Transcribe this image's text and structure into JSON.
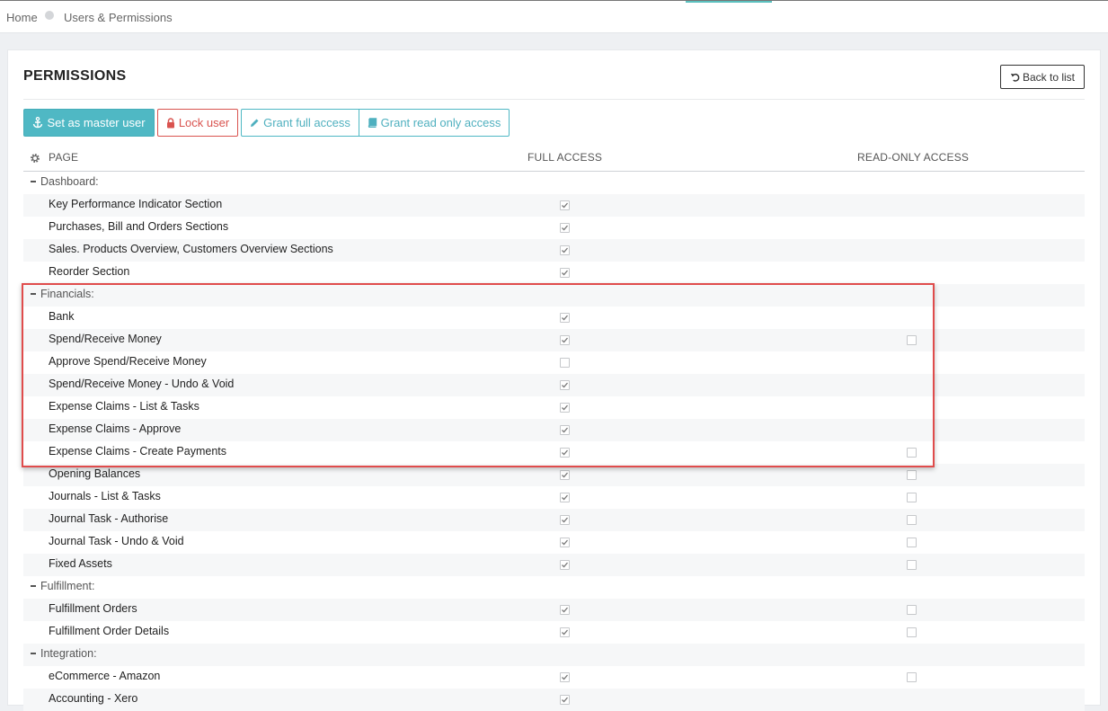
{
  "breadcrumb": {
    "home": "Home",
    "current": "Users & Permissions"
  },
  "card": {
    "title": "PERMISSIONS",
    "back_label": "Back to list"
  },
  "actions": {
    "master": "Set as master user",
    "lock": "Lock user",
    "grant_full": "Grant full access",
    "grant_read": "Grant read only access"
  },
  "table": {
    "col_page": "PAGE",
    "col_full": "FULL ACCESS",
    "col_read": "READ-ONLY ACCESS",
    "rows": [
      {
        "type": "group",
        "label": "Dashboard:"
      },
      {
        "type": "item",
        "label": "Key Performance Indicator Section",
        "full": true,
        "read": null
      },
      {
        "type": "item",
        "label": "Purchases, Bill and Orders Sections",
        "full": true,
        "read": null
      },
      {
        "type": "item",
        "label": "Sales. Products Overview, Customers Overview Sections",
        "full": true,
        "read": null
      },
      {
        "type": "item",
        "label": "Reorder Section",
        "full": true,
        "read": null
      },
      {
        "type": "group",
        "label": "Financials:"
      },
      {
        "type": "item",
        "label": "Bank",
        "full": true,
        "read": null
      },
      {
        "type": "item",
        "label": "Spend/Receive Money",
        "full": true,
        "read": false
      },
      {
        "type": "item",
        "label": "Approve Spend/Receive Money",
        "full": false,
        "read": null
      },
      {
        "type": "item",
        "label": "Spend/Receive Money - Undo & Void",
        "full": true,
        "read": null
      },
      {
        "type": "item",
        "label": "Expense Claims - List & Tasks",
        "full": true,
        "read": null
      },
      {
        "type": "item",
        "label": "Expense Claims - Approve",
        "full": true,
        "read": null
      },
      {
        "type": "item",
        "label": "Expense Claims - Create Payments",
        "full": true,
        "read": false
      },
      {
        "type": "item",
        "label": "Opening Balances",
        "full": true,
        "read": false
      },
      {
        "type": "item",
        "label": "Journals - List & Tasks",
        "full": true,
        "read": false
      },
      {
        "type": "item",
        "label": "Journal Task - Authorise",
        "full": true,
        "read": false
      },
      {
        "type": "item",
        "label": "Journal Task - Undo & Void",
        "full": true,
        "read": false
      },
      {
        "type": "item",
        "label": "Fixed Assets",
        "full": true,
        "read": false
      },
      {
        "type": "group",
        "label": "Fulfillment:"
      },
      {
        "type": "item",
        "label": "Fulfillment Orders",
        "full": true,
        "read": false
      },
      {
        "type": "item",
        "label": "Fulfillment Order Details",
        "full": true,
        "read": false
      },
      {
        "type": "group",
        "label": "Integration:"
      },
      {
        "type": "item",
        "label": "eCommerce - Amazon",
        "full": true,
        "read": false
      },
      {
        "type": "item",
        "label": "Accounting - Xero",
        "full": true,
        "read": null
      }
    ]
  },
  "icons": {
    "settings": "gear-icon",
    "back": "undo-icon",
    "master": "anchor-icon",
    "lock": "lock-icon",
    "full": "pencil-icon",
    "read": "book-icon",
    "check": "checkmark-icon"
  },
  "colors": {
    "accent": "#4fb8c4",
    "danger": "#d9534f",
    "highlight": "#e04c4c"
  }
}
